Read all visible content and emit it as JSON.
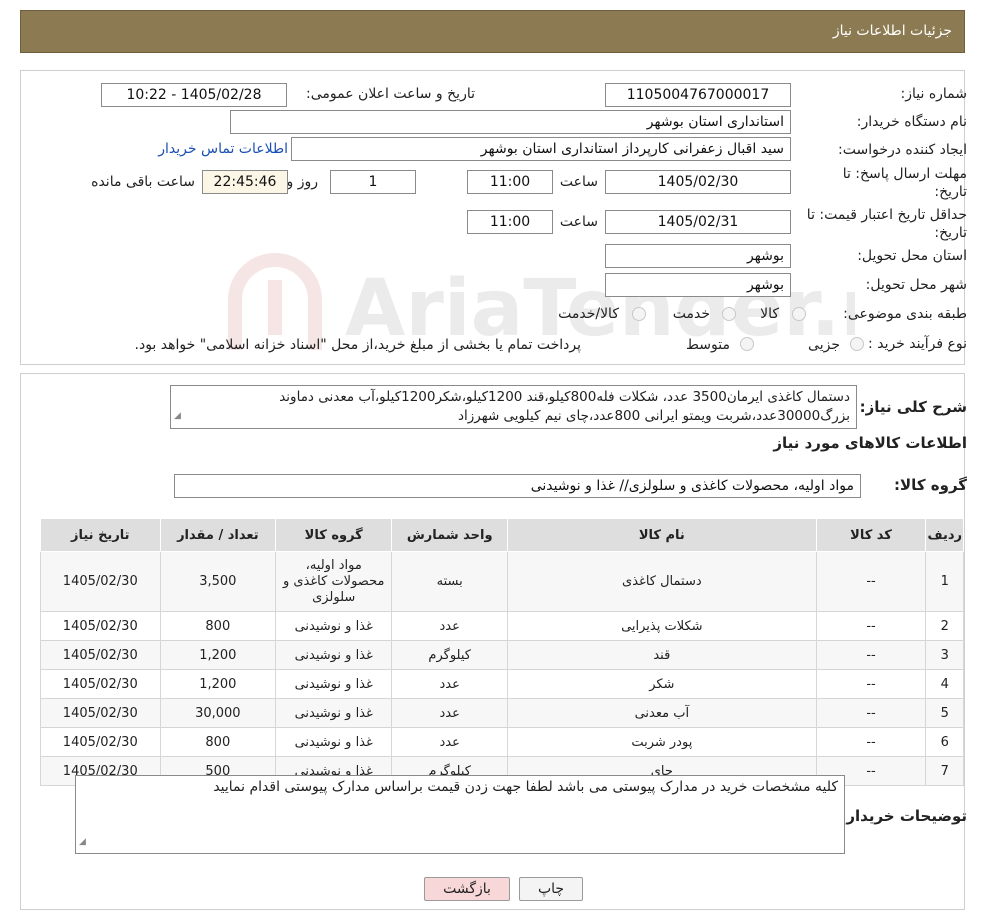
{
  "header": {
    "title": "جزئیات اطلاعات نیاز"
  },
  "form": {
    "need_number_label": "شماره نیاز:",
    "need_number": "1105004767000017",
    "announce_label": "تاریخ و ساعت اعلان عمومی:",
    "announce_value": "1405/02/28 - 10:22",
    "buyer_org_label": "نام دستگاه خریدار:",
    "buyer_org": "استانداری استان بوشهر",
    "requester_label": "ایجاد کننده درخواست:",
    "requester": "سید اقبال زعفرانی کارپرداز استانداری استان بوشهر",
    "contact_link": "اطلاعات تماس خریدار",
    "deadline_label": "مهلت ارسال پاسخ: تا تاریخ:",
    "deadline_date": "1405/02/30",
    "time_label": "ساعت",
    "deadline_time": "11:00",
    "days_value": "1",
    "days_label": "روز و",
    "remaining_time": "22:45:46",
    "remaining_label": "ساعت باقی مانده",
    "validity_label": "حداقل تاریخ اعتبار قیمت: تا تاریخ:",
    "validity_date": "1405/02/31",
    "validity_time": "11:00",
    "province_label": "استان محل تحویل:",
    "province": "بوشهر",
    "city_label": "شهر محل تحویل:",
    "city": "بوشهر",
    "category_label": "طبقه بندی موضوعی:",
    "category_options": [
      "کالا",
      "خدمت",
      "کالا/خدمت"
    ],
    "process_label": "نوع فرآیند خرید :",
    "process_options": [
      "جزیی",
      "متوسط"
    ],
    "process_note": "پرداخت تمام یا بخشی از مبلغ خرید،از محل \"اسناد خزانه اسلامی\" خواهد بود."
  },
  "summary": {
    "label": "شرح کلی نیاز:",
    "line1": "دستمال کاغذی ایرمان3500 عدد، شکلات فله800کیلو،قند 1200کیلو،شکر1200کیلو،آب معدنی دماوند",
    "line2": "بزرگ30000عدد،شربت ویمتو ایرانی 800عدد،چای نیم کیلویی شهرزاد",
    "items_title": "اطلاعات کالاهای مورد نیاز",
    "group_label": "گروه کالا:",
    "group_value": "مواد اولیه، محصولات کاغذی و سلولزی// غذا و نوشیدنی"
  },
  "table": {
    "headers": [
      "ردیف",
      "کد کالا",
      "نام کالا",
      "واحد شمارش",
      "گروه کالا",
      "تعداد / مقدار",
      "تاریخ نیاز"
    ],
    "rows": [
      [
        "1",
        "--",
        "دستمال کاغذی",
        "بسته",
        "مواد اولیه، محصولات کاغذی و سلولزی",
        "3,500",
        "1405/02/30"
      ],
      [
        "2",
        "--",
        "شکلات پذیرایی",
        "عدد",
        "غذا و نوشیدنی",
        "800",
        "1405/02/30"
      ],
      [
        "3",
        "--",
        "قند",
        "کیلوگرم",
        "غذا و نوشیدنی",
        "1,200",
        "1405/02/30"
      ],
      [
        "4",
        "--",
        "شکر",
        "عدد",
        "غذا و نوشیدنی",
        "1,200",
        "1405/02/30"
      ],
      [
        "5",
        "--",
        "آب معدنی",
        "عدد",
        "غذا و نوشیدنی",
        "30,000",
        "1405/02/30"
      ],
      [
        "6",
        "--",
        "پودر شربت",
        "عدد",
        "غذا و نوشیدنی",
        "800",
        "1405/02/30"
      ],
      [
        "7",
        "--",
        "چای",
        "کیلوگرم",
        "غذا و نوشیدنی",
        "500",
        "1405/02/30"
      ]
    ]
  },
  "buyer_notes": {
    "label": "توضیحات خریدار:",
    "text": "کلیه مشخصات خرید در مدارک پیوستی می باشد لطفا جهت زدن قیمت براساس مدارک پیوستی اقدام نمایید"
  },
  "buttons": {
    "print": "چاپ",
    "back": "بازگشت"
  },
  "colors": {
    "header": "#8c7a52",
    "link": "#1a4fb3",
    "back_button": "#f7d7d7"
  }
}
